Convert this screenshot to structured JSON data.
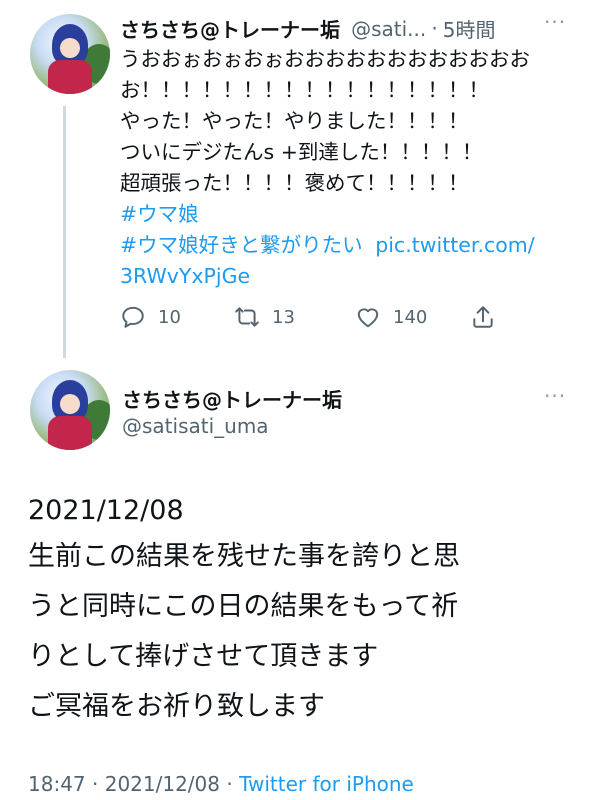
{
  "tweet1": {
    "name": "さちさち@トレーナー垢",
    "handle": "@sati...",
    "separator": "·",
    "time": "5時間",
    "lines": [
      "うおおぉおぉおぉおおおおおおおおおおおお",
      "お！！！！！！！！！！！！！！！！！",
      "やった！やった！やりました！！！！",
      "ついにデジたんs +到達した！！！！！",
      "超頑張った！！！！褒めて！！！！！"
    ],
    "hashtag1": "#ウマ娘",
    "hashtag2": "#ウマ娘好きと繋がりたい",
    "link_part1": "pic.twitter.com/",
    "link_part2": "3RWvYxPjGe",
    "reply_count": "10",
    "retweet_count": "13",
    "like_count": "140",
    "icons": [
      "reply-icon",
      "retweet-icon",
      "like-icon",
      "share-icon"
    ]
  },
  "tweet2": {
    "name": "さちさち@トレーナー垢",
    "handle": "@satisati_uma",
    "lines": [
      "2021/12/08",
      "生前この結果を残せた事を誇りと思",
      "うと同時にこの日の結果をもって祈",
      "りとして捧げさせて頂きます",
      "ご冥福をお祈り致します"
    ],
    "time": "18:47",
    "date": "2021/12/08",
    "separator": "·",
    "source": "Twitter for iPhone"
  },
  "more_label": "···",
  "colors": {
    "link": "#1d9bf0",
    "secondary_text": "#536471",
    "thread_line": "#cfd9de"
  }
}
